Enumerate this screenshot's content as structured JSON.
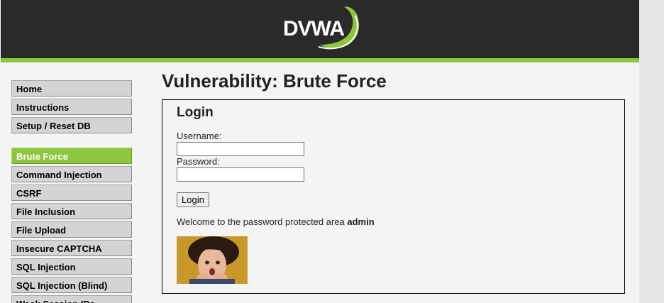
{
  "header": {
    "logo_text": "DVWA",
    "colors": {
      "background": "#2a2a2a",
      "accent": "#8dc63f"
    }
  },
  "menu": {
    "group1": [
      {
        "label": "Home"
      },
      {
        "label": "Instructions"
      },
      {
        "label": "Setup / Reset DB"
      }
    ],
    "group2": [
      {
        "label": "Brute Force",
        "active": true
      },
      {
        "label": "Command Injection"
      },
      {
        "label": "CSRF"
      },
      {
        "label": "File Inclusion"
      },
      {
        "label": "File Upload"
      },
      {
        "label": "Insecure CAPTCHA"
      },
      {
        "label": "SQL Injection"
      },
      {
        "label": "SQL Injection (Blind)"
      },
      {
        "label": "Weak Session IDs"
      }
    ]
  },
  "main": {
    "title": "Vulnerability: Brute Force",
    "login": {
      "heading": "Login",
      "username_label": "Username:",
      "username_value": "",
      "password_label": "Password:",
      "password_value": "",
      "button_label": "Login",
      "welcome_prefix": "Welcome to the password protected area ",
      "welcome_user": "admin",
      "avatar_icon": "user-photo"
    }
  }
}
